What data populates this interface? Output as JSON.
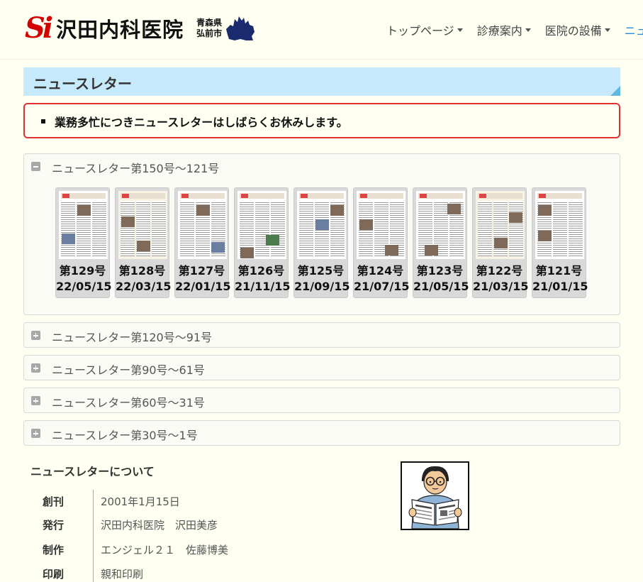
{
  "header": {
    "logo_mark": "Si",
    "clinic_name": "沢田内科医院",
    "place_line1": "青森県",
    "place_line2": "弘前市",
    "nav": [
      {
        "label": "トップページ",
        "caret": true
      },
      {
        "label": "診療案内",
        "caret": true
      },
      {
        "label": "医院の設備",
        "caret": true
      },
      {
        "label": "ニュ",
        "caret": false
      }
    ]
  },
  "section_title": "ニュースレター",
  "notice": "業務多忙につきニュースレターはしばらくお休みします。",
  "panels": [
    {
      "label": "ニュースレター第150号〜121号",
      "expanded": true
    },
    {
      "label": "ニュースレター第120号〜91号",
      "expanded": false
    },
    {
      "label": "ニュースレター第90号〜61号",
      "expanded": false
    },
    {
      "label": "ニュースレター第60号〜31号",
      "expanded": false
    },
    {
      "label": "ニュースレター第30号〜1号",
      "expanded": false
    }
  ],
  "issues": [
    {
      "number": "第129号",
      "date": "22/05/15"
    },
    {
      "number": "第128号",
      "date": "22/03/15"
    },
    {
      "number": "第127号",
      "date": "22/01/15"
    },
    {
      "number": "第126号",
      "date": "21/11/15"
    },
    {
      "number": "第125号",
      "date": "21/09/15"
    },
    {
      "number": "第124号",
      "date": "21/07/15"
    },
    {
      "number": "第123号",
      "date": "21/05/15"
    },
    {
      "number": "第122号",
      "date": "21/03/15"
    },
    {
      "number": "第121号",
      "date": "21/01/15"
    }
  ],
  "about": {
    "title": "ニュースレターについて",
    "rows": [
      {
        "key": "創刊",
        "value": "2001年1月15日"
      },
      {
        "key": "発行",
        "value": "沢田内科医院　沢田美彦"
      },
      {
        "key": "制作",
        "value": "エンジェル２１　佐藤博美"
      },
      {
        "key": "印刷",
        "value": "親和印刷"
      }
    ]
  },
  "colors": {
    "background": "#fffff2",
    "title_band": "#c6e9fb",
    "notice_border": "#e03030",
    "logo_red": "#d40000",
    "map_navy": "#1a2a6c"
  }
}
